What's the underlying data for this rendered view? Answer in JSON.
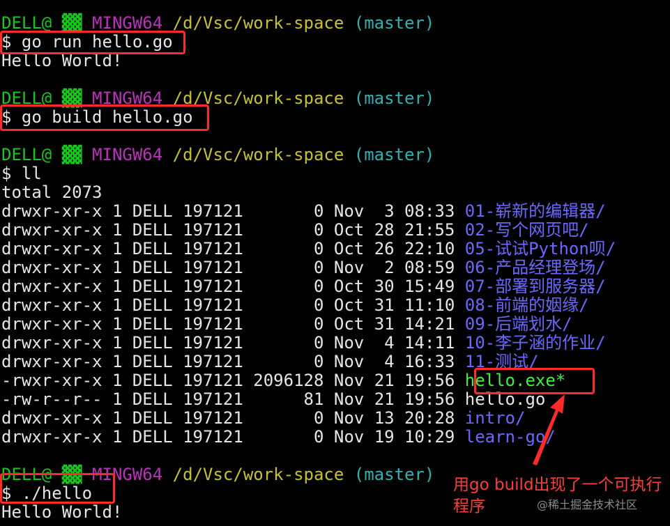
{
  "prompt": {
    "user": "DELL@",
    "host_glyph": "▓▓",
    "system": "MINGW64",
    "path": "/d/Vsc/work-space",
    "branch": "(master)",
    "symbol": "$"
  },
  "commands": [
    {
      "cmd": " go run hello.go",
      "output": [
        "Hello World!"
      ]
    },
    {
      "cmd": " go build hello.go",
      "output": []
    },
    {
      "cmd": " ll",
      "output": []
    },
    {
      "cmd": " ./hello",
      "output": [
        "Hello World!"
      ]
    }
  ],
  "listing": {
    "total": "total 2073",
    "rows": [
      {
        "perm": "drwxr-xr-x",
        "links": "1",
        "owner": "DELL",
        "group": "197121",
        "size": "0",
        "month": "Nov",
        "day": "3",
        "time": "08:33",
        "name": "01-崭新的编辑器/",
        "kind": "dir"
      },
      {
        "perm": "drwxr-xr-x",
        "links": "1",
        "owner": "DELL",
        "group": "197121",
        "size": "0",
        "month": "Oct",
        "day": "28",
        "time": "21:55",
        "name": "02-写个网页吧/",
        "kind": "dir"
      },
      {
        "perm": "drwxr-xr-x",
        "links": "1",
        "owner": "DELL",
        "group": "197121",
        "size": "0",
        "month": "Oct",
        "day": "26",
        "time": "22:10",
        "name": "05-试试Python呗/",
        "kind": "dir"
      },
      {
        "perm": "drwxr-xr-x",
        "links": "1",
        "owner": "DELL",
        "group": "197121",
        "size": "0",
        "month": "Nov",
        "day": "2",
        "time": "08:59",
        "name": "06-产品经理登场/",
        "kind": "dir"
      },
      {
        "perm": "drwxr-xr-x",
        "links": "1",
        "owner": "DELL",
        "group": "197121",
        "size": "0",
        "month": "Oct",
        "day": "30",
        "time": "15:49",
        "name": "07-部署到服务器/",
        "kind": "dir"
      },
      {
        "perm": "drwxr-xr-x",
        "links": "1",
        "owner": "DELL",
        "group": "197121",
        "size": "0",
        "month": "Oct",
        "day": "31",
        "time": "11:10",
        "name": "08-前端的姻缘/",
        "kind": "dir"
      },
      {
        "perm": "drwxr-xr-x",
        "links": "1",
        "owner": "DELL",
        "group": "197121",
        "size": "0",
        "month": "Oct",
        "day": "31",
        "time": "14:21",
        "name": "09-后端划水/",
        "kind": "dir"
      },
      {
        "perm": "drwxr-xr-x",
        "links": "1",
        "owner": "DELL",
        "group": "197121",
        "size": "0",
        "month": "Nov",
        "day": "4",
        "time": "14:11",
        "name": "10-李子涵的作业/",
        "kind": "dir"
      },
      {
        "perm": "drwxr-xr-x",
        "links": "1",
        "owner": "DELL",
        "group": "197121",
        "size": "0",
        "month": "Nov",
        "day": "4",
        "time": "16:33",
        "name": "11-测试/",
        "kind": "dir"
      },
      {
        "perm": "-rwxr-xr-x",
        "links": "1",
        "owner": "DELL",
        "group": "197121",
        "size": "2096128",
        "month": "Nov",
        "day": "21",
        "time": "19:56",
        "name": "hello.exe*",
        "kind": "exe"
      },
      {
        "perm": "-rw-r--r--",
        "links": "1",
        "owner": "DELL",
        "group": "197121",
        "size": "81",
        "month": "Nov",
        "day": "21",
        "time": "19:56",
        "name": "hello.go",
        "kind": "file"
      },
      {
        "perm": "drwxr-xr-x",
        "links": "1",
        "owner": "DELL",
        "group": "197121",
        "size": "0",
        "month": "Nov",
        "day": "13",
        "time": "20:28",
        "name": "intro/",
        "kind": "dir"
      },
      {
        "perm": "drwxr-xr-x",
        "links": "1",
        "owner": "DELL",
        "group": "197121",
        "size": "0",
        "month": "Nov",
        "day": "19",
        "time": "10:29",
        "name": "learn-go/",
        "kind": "dir"
      }
    ]
  },
  "annotation": {
    "note": "用go build出现了一个可执行程序",
    "watermark": "@稀土掘金技术社区",
    "color": "#ff2a2a"
  },
  "colors": {
    "background": "#000000",
    "user": "#14c81c",
    "system": "#bf2fbf",
    "path": "#c9c22a",
    "branch": "#2ab4b4",
    "directory": "#6969ff",
    "executable": "#3cf03c"
  }
}
